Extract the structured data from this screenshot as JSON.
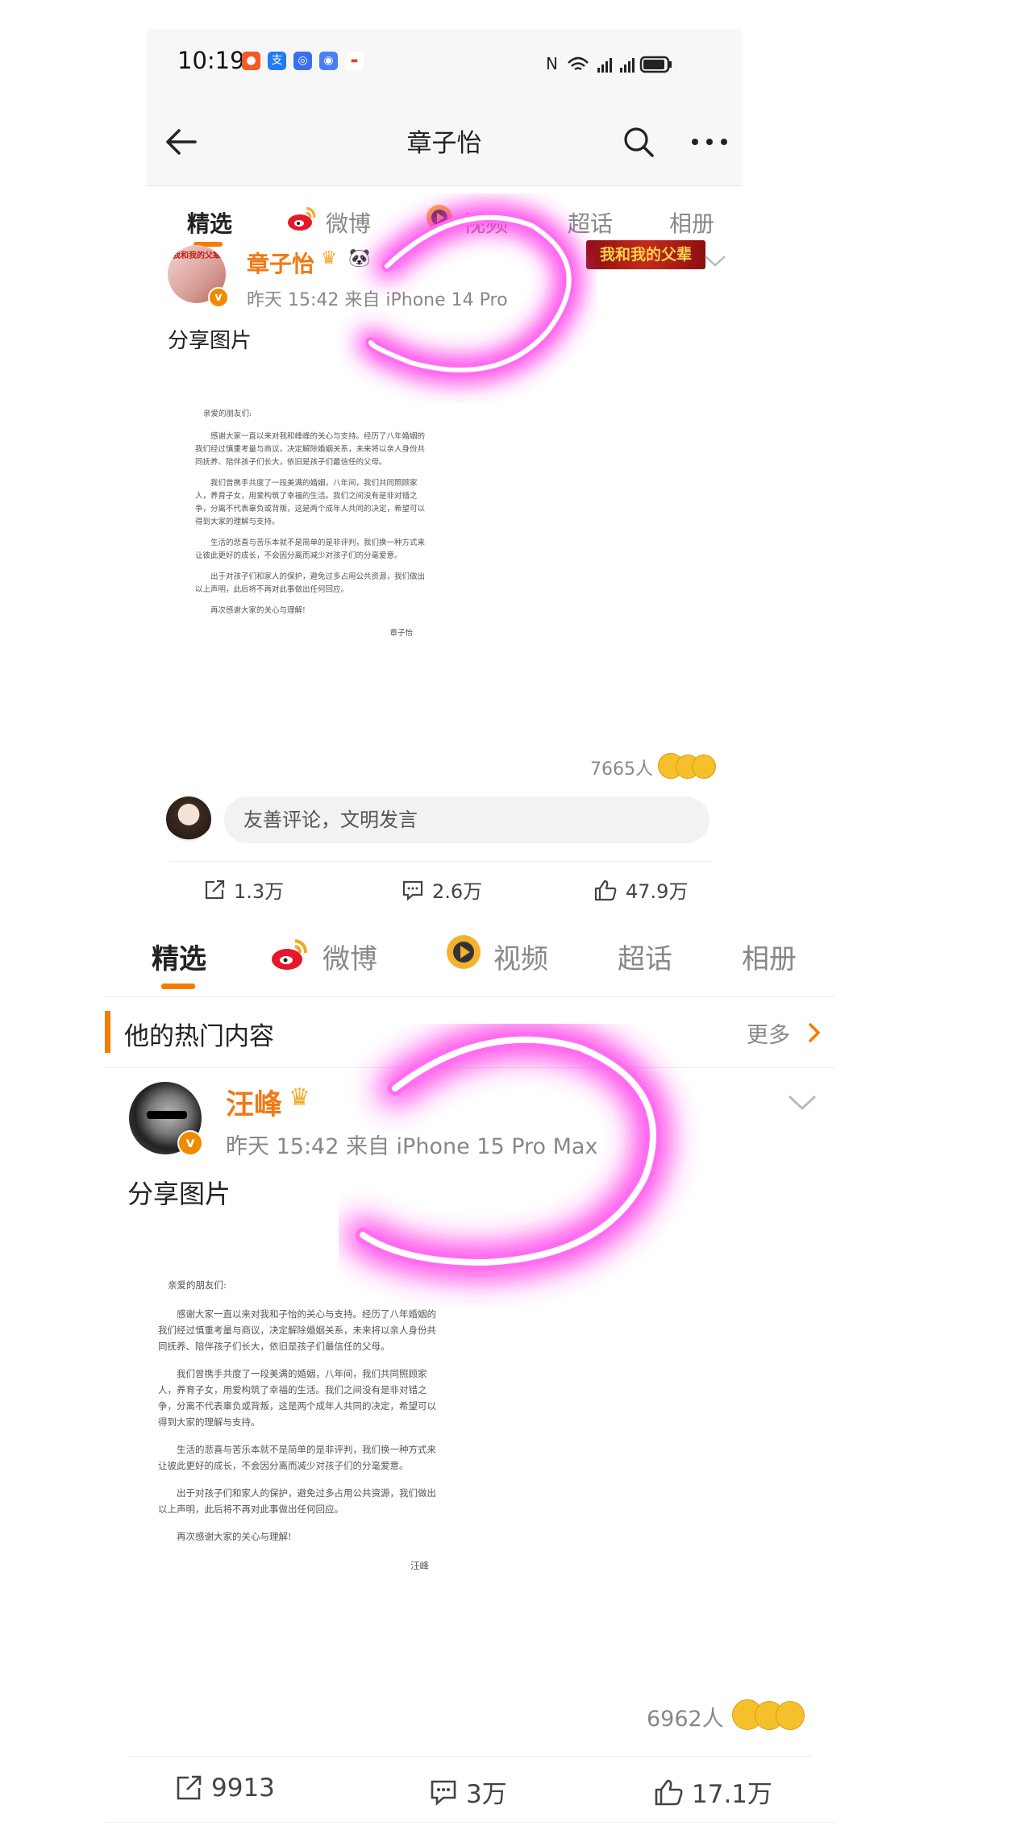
{
  "status_bar": {
    "time": "10:19"
  },
  "nav": {
    "title": "章子怡"
  },
  "tabs1": [
    "精选",
    "微博",
    "视频",
    "超话",
    "相册"
  ],
  "post1": {
    "username": "章子怡",
    "meta": "昨天 15:42  来自 iPhone 14 Pro",
    "text": "分享图片",
    "badge_text": "我和我的父辈",
    "reactions": "7665人",
    "comment_placeholder": "友善评论，文明发言",
    "share": "1.3万",
    "comment": "2.6万",
    "like": "47.9万",
    "letter": {
      "greeting": "亲爱的朋友们:",
      "p1": "感谢大家一直以来对我和峰峰的关心与支持。经历了八年婚姻的我们经过慎重考量与商议，决定解除婚姻关系，未来将以亲人身份共同抚养、陪伴孩子们长大，依旧是孩子们最信任的父母。",
      "p2": "我们曾携手共度了一段美满的婚姻，八年间，我们共同照顾家人，养育子女，用爱构筑了幸福的生活。我们之间没有是非对错之争，分离不代表辜负或背叛，这是两个成年人共同的决定，希望可以得到大家的理解与支持。",
      "p3": "生活的悲喜与苦乐本就不是简单的是非评判，我们换一种方式来让彼此更好的成长，不会因分离而减少对孩子们的分毫爱意。",
      "p4": "出于对孩子们和家人的保护，避免过多占用公共资源，我们做出以上声明，此后将不再对此事做出任何回应。",
      "p5": "再次感谢大家的关心与理解!",
      "sign": "章子怡"
    }
  },
  "tabs2": [
    "精选",
    "微博",
    "视频",
    "超话",
    "相册"
  ],
  "hot_section": {
    "title": "他的热门内容",
    "more": "更多"
  },
  "post2": {
    "username": "汪峰",
    "meta": "昨天 15:42   来自 iPhone 15 Pro Max",
    "text": "分享图片",
    "reactions": "6962人",
    "share": "9913",
    "comment": "3万",
    "like": "17.1万",
    "letter": {
      "greeting": "亲爱的朋友们:",
      "p1": "感谢大家一直以来对我和子怡的关心与支持。经历了八年婚姻的我们经过慎重考量与商议，决定解除婚姻关系，未来将以亲人身份共同抚养、陪伴孩子们长大，依旧是孩子们最信任的父母。",
      "p2": "我们曾携手共度了一段美满的婚姻，八年间，我们共同照顾家人，养育子女，用爱构筑了幸福的生活。我们之间没有是非对错之争，分离不代表辜负或背叛，这是两个成年人共同的决定，希望可以得到大家的理解与支持。",
      "p3": "生活的悲喜与苦乐本就不是简单的是非评判，我们换一种方式来让彼此更好的成长，不会因分离而减少对孩子们的分毫爱意。",
      "p4": "出于对孩子们和家人的保护，避免过多占用公共资源，我们做出以上声明，此后将不再对此事做出任何回应。",
      "p5": "再次感谢大家的关心与理解!",
      "sign": "汪峰"
    }
  },
  "colors": {
    "accent": "#f57c00",
    "username": "#f07a13",
    "glow": "#ff33ee"
  }
}
